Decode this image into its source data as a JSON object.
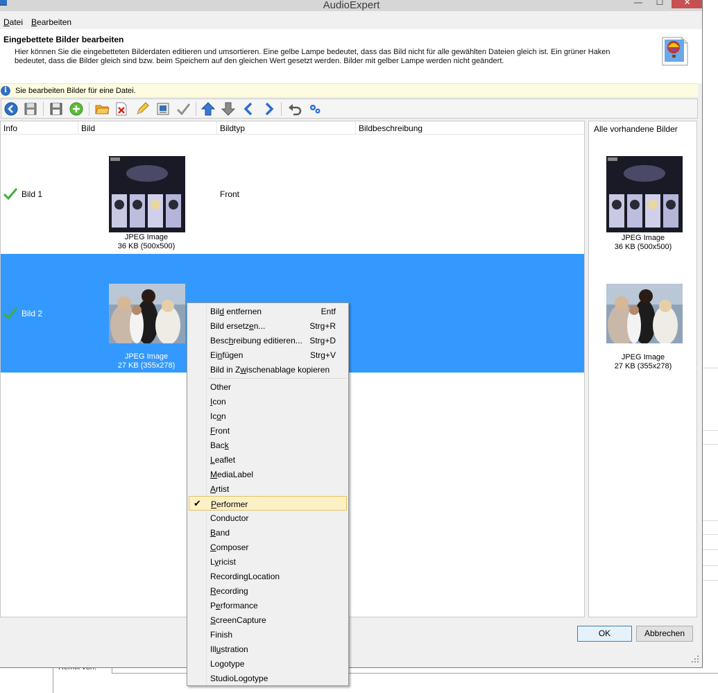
{
  "window": {
    "title": "AudioExpert",
    "controls": {
      "minimize": "—",
      "maximize": "☐",
      "close": "✕"
    }
  },
  "menubar": [
    {
      "label_plain": "",
      "label_u": "D",
      "label_rest": "atei"
    },
    {
      "label_plain": "",
      "label_u": "B",
      "label_rest": "earbeiten"
    }
  ],
  "header": {
    "title": "Eingebettete Bilder bearbeiten",
    "description": "Hier können Sie die eingebetteten Bilderdaten editieren und umsortieren. Eine gelbe Lampe bedeutet, dass das Bild nicht für alle gewählten Dateien gleich ist. Ein grüner Haken bedeutet, dass die Bilder gleich sind bzw. beim Speichern auf den gleichen Wert gesetzt werden. Bilder mit gelber Lampe werden nicht geändert."
  },
  "infobar": {
    "text": "Sie bearbeiten Bilder für eine Datei."
  },
  "grid": {
    "columns": [
      "Info",
      "Bild",
      "Bildtyp",
      "Bildbeschreibung"
    ],
    "rows": [
      {
        "label": "Bild 1",
        "type": "Front",
        "description": "",
        "format": "JPEG Image",
        "size": "36 KB (500x500)",
        "selected": false
      },
      {
        "label": "Bild 2",
        "type": "",
        "description": "",
        "format": "JPEG Image",
        "size": "27 KB (355x278)",
        "selected": true
      }
    ]
  },
  "right_panel": {
    "title": "Alle vorhandene Bilder",
    "images": [
      {
        "format": "JPEG Image",
        "size": "36 KB (500x500)"
      },
      {
        "format": "JPEG Image",
        "size": "27 KB (355x278)"
      }
    ]
  },
  "buttons": {
    "ok": "OK",
    "cancel": "Abbrechen"
  },
  "background": {
    "fragment": "Remix von:"
  },
  "context_menu": {
    "actions": [
      {
        "pre": "Bil",
        "u": "d",
        "post": " entfernen",
        "shortcut": "Entf"
      },
      {
        "pre": "Bild ersetz",
        "u": "e",
        "post": "n...",
        "shortcut": "Strg+R"
      },
      {
        "pre": "Besc",
        "u": "h",
        "post": "reibung editieren...",
        "shortcut": "Strg+D"
      },
      {
        "pre": "Ei",
        "u": "n",
        "post": "fügen",
        "shortcut": "Strg+V"
      },
      {
        "pre": "Bild in Z",
        "u": "w",
        "post": "ischenablage kopieren",
        "shortcut": ""
      }
    ],
    "types": [
      {
        "pre": "",
        "u": "",
        "post": "Other",
        "checked": false
      },
      {
        "pre": "",
        "u": "I",
        "post": "con",
        "checked": false
      },
      {
        "pre": "Ic",
        "u": "o",
        "post": "n",
        "checked": false
      },
      {
        "pre": "",
        "u": "F",
        "post": "ront",
        "checked": false
      },
      {
        "pre": "Bac",
        "u": "k",
        "post": "",
        "checked": false
      },
      {
        "pre": "",
        "u": "L",
        "post": "eaflet",
        "checked": false
      },
      {
        "pre": "",
        "u": "M",
        "post": "ediaLabel",
        "checked": false
      },
      {
        "pre": "",
        "u": "A",
        "post": "rtist",
        "checked": false
      },
      {
        "pre": "",
        "u": "P",
        "post": "erformer",
        "checked": true
      },
      {
        "pre": "",
        "u": "",
        "post": "Conductor",
        "checked": false
      },
      {
        "pre": "",
        "u": "B",
        "post": "and",
        "checked": false
      },
      {
        "pre": "",
        "u": "C",
        "post": "omposer",
        "checked": false
      },
      {
        "pre": "L",
        "u": "y",
        "post": "ricist",
        "checked": false
      },
      {
        "pre": "",
        "u": "",
        "post": "RecordingLocation",
        "checked": false
      },
      {
        "pre": "",
        "u": "R",
        "post": "ecording",
        "checked": false
      },
      {
        "pre": "P",
        "u": "e",
        "post": "rformance",
        "checked": false
      },
      {
        "pre": "",
        "u": "S",
        "post": "creenCapture",
        "checked": false
      },
      {
        "pre": "",
        "u": "",
        "post": "Finish",
        "checked": false
      },
      {
        "pre": "Ill",
        "u": "u",
        "post": "stration",
        "checked": false
      },
      {
        "pre": "Lo",
        "u": "g",
        "post": "otype",
        "checked": false
      },
      {
        "pre": "",
        "u": "",
        "post": "StudioLogotype",
        "checked": false
      }
    ]
  },
  "colors": {
    "selection": "#3399ff",
    "highlight": "#fcf0c5",
    "info_bg": "#fdfbe0"
  },
  "icons": [
    "app-icon",
    "info-icon",
    "back-icon",
    "save-all-icon",
    "save-icon",
    "add-icon",
    "open-folder-icon",
    "delete-icon",
    "edit-icon",
    "screenshot-icon",
    "apply-check-icon",
    "move-top-icon",
    "move-bottom-icon",
    "move-up-icon",
    "move-down-icon",
    "undo-icon",
    "settings-icon",
    "green-check-icon",
    "balloon-image-icon"
  ]
}
